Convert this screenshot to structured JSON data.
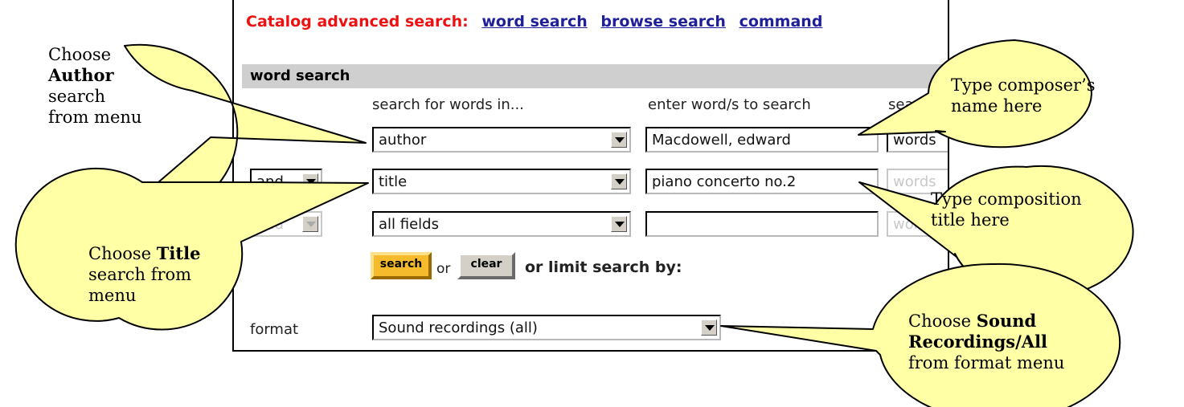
{
  "header": {
    "lead": "Catalog advanced search:",
    "links": [
      "word search",
      "browse search",
      "command"
    ]
  },
  "section_title": "word search",
  "columns": {
    "fields": "search for words in...",
    "terms": "enter word/s to search",
    "type": "search"
  },
  "rows": [
    {
      "operator": "",
      "field": "author",
      "term": "Macdowell, edward",
      "type": "words"
    },
    {
      "operator": "and",
      "field": "title",
      "term": "piano concerto no.2",
      "type": "words"
    },
    {
      "operator": "and",
      "field": "all fields",
      "term": "",
      "type": "words"
    }
  ],
  "actions": {
    "search": "search",
    "or": "or",
    "clear": "clear",
    "limit": "or limit search by:"
  },
  "format": {
    "label": "format",
    "value": "Sound recordings (all)"
  },
  "callouts": {
    "author": {
      "line1": "Choose",
      "bold": "Author",
      "line3": "search",
      "line4": "from menu"
    },
    "title": {
      "pre": "Choose",
      "bold": "Title",
      "line2": "search from",
      "line3": "menu"
    },
    "composer": {
      "line1": "Type composer’s",
      "line2": "name here"
    },
    "composition": {
      "line1": "Type composition",
      "line2": "title here"
    },
    "format": {
      "pre": "Choose",
      "bold1": "Sound",
      "bold2": "Recordings/All",
      "line3": "from format menu"
    }
  },
  "colors": {
    "callout_fill": "#ffffa6",
    "header_red": "#ee1111",
    "link_blue": "#1f1f99",
    "search_button": "#f6bb2c"
  }
}
